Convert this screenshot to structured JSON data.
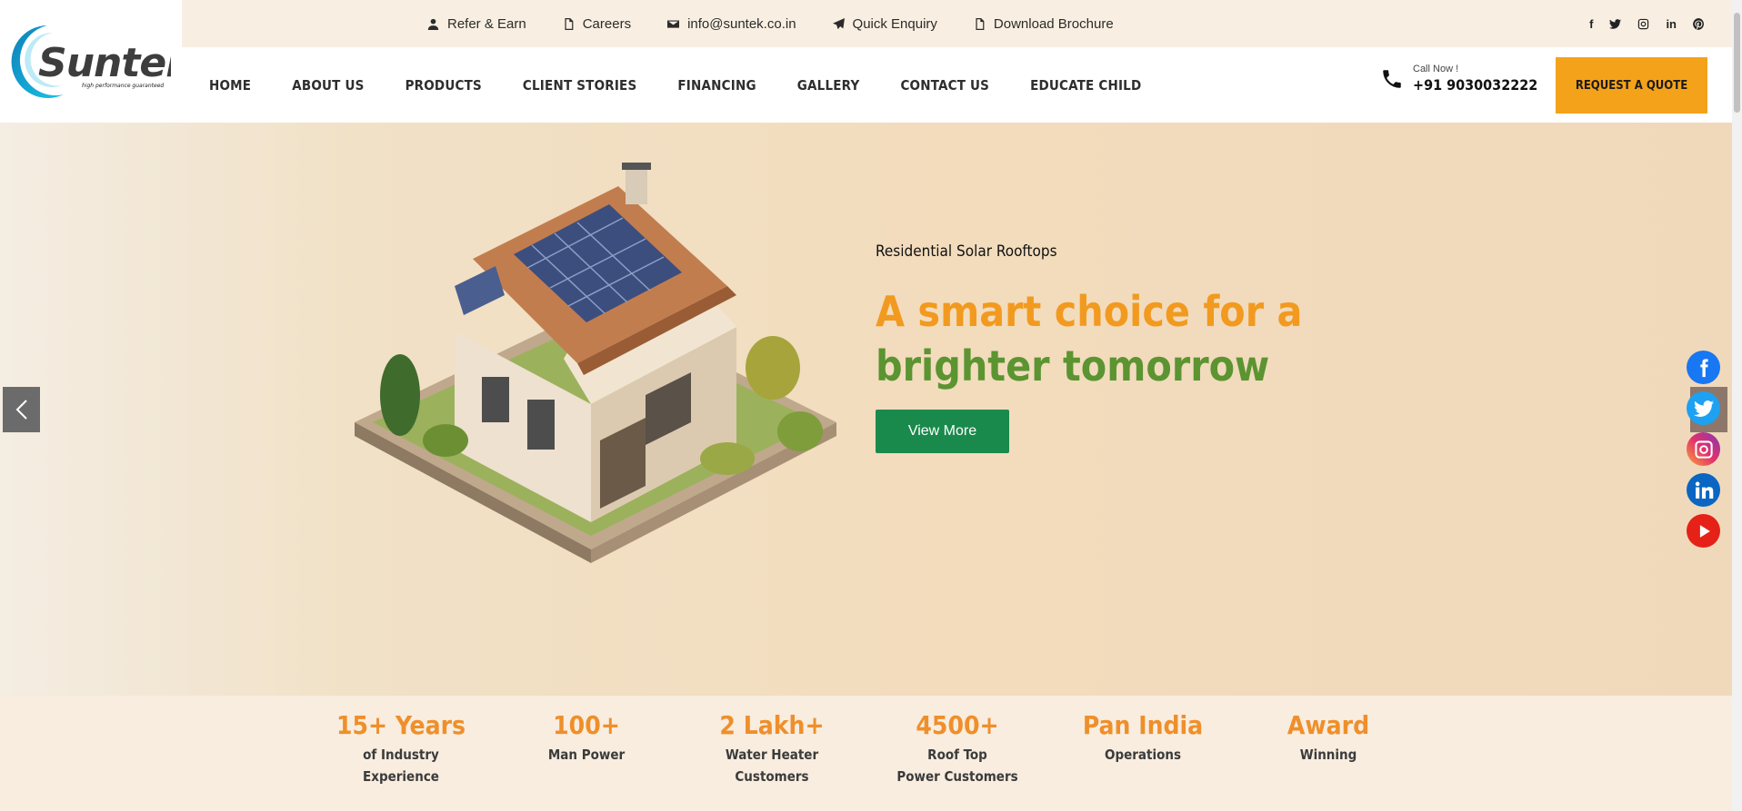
{
  "topbar": {
    "links": [
      {
        "label": "Refer & Earn",
        "icon": "user-icon"
      },
      {
        "label": "Careers",
        "icon": "document-icon"
      },
      {
        "label": "info@suntek.co.in",
        "icon": "envelope-icon"
      },
      {
        "label": "Quick Enquiry",
        "icon": "paper-plane-icon"
      },
      {
        "label": "Download Brochure",
        "icon": "document-icon"
      }
    ],
    "social": [
      "facebook-icon",
      "twitter-icon",
      "instagram-icon",
      "linkedin-icon",
      "pinterest-icon"
    ]
  },
  "logo": {
    "brand": "Suntek",
    "tagline": "high performance guaranteed"
  },
  "nav": {
    "items": [
      "HOME",
      "ABOUT US",
      "PRODUCTS",
      "CLIENT STORIES",
      "FINANCING",
      "GALLERY",
      "CONTACT US",
      "EDUCATE CHILD"
    ],
    "call_label": "Call Now !",
    "call_number": "+91 9030032222",
    "quote_button": "REQUEST A QUOTE"
  },
  "hero": {
    "kicker": "Residential Solar Rooftops",
    "title_line1": "A smart choice for a",
    "title_line2": "brighter tomorrow",
    "button": "View More"
  },
  "stats": [
    {
      "value": "15+ Years",
      "label": "of Industry\nExperience"
    },
    {
      "value": "100+",
      "label": "Man Power"
    },
    {
      "value": "2 Lakh+",
      "label": "Water Heater\nCustomers"
    },
    {
      "value": "4500+",
      "label": "Roof Top\nPower Customers"
    },
    {
      "value": "Pan India",
      "label": "Operations"
    },
    {
      "value": "Award",
      "label": "Winning"
    }
  ],
  "colors": {
    "accent_orange": "#f5a21b",
    "title_orange": "#f29a1f",
    "title_green": "#5b9431",
    "button_green": "#1a8a4c",
    "topbar_bg": "#f8efe2"
  }
}
